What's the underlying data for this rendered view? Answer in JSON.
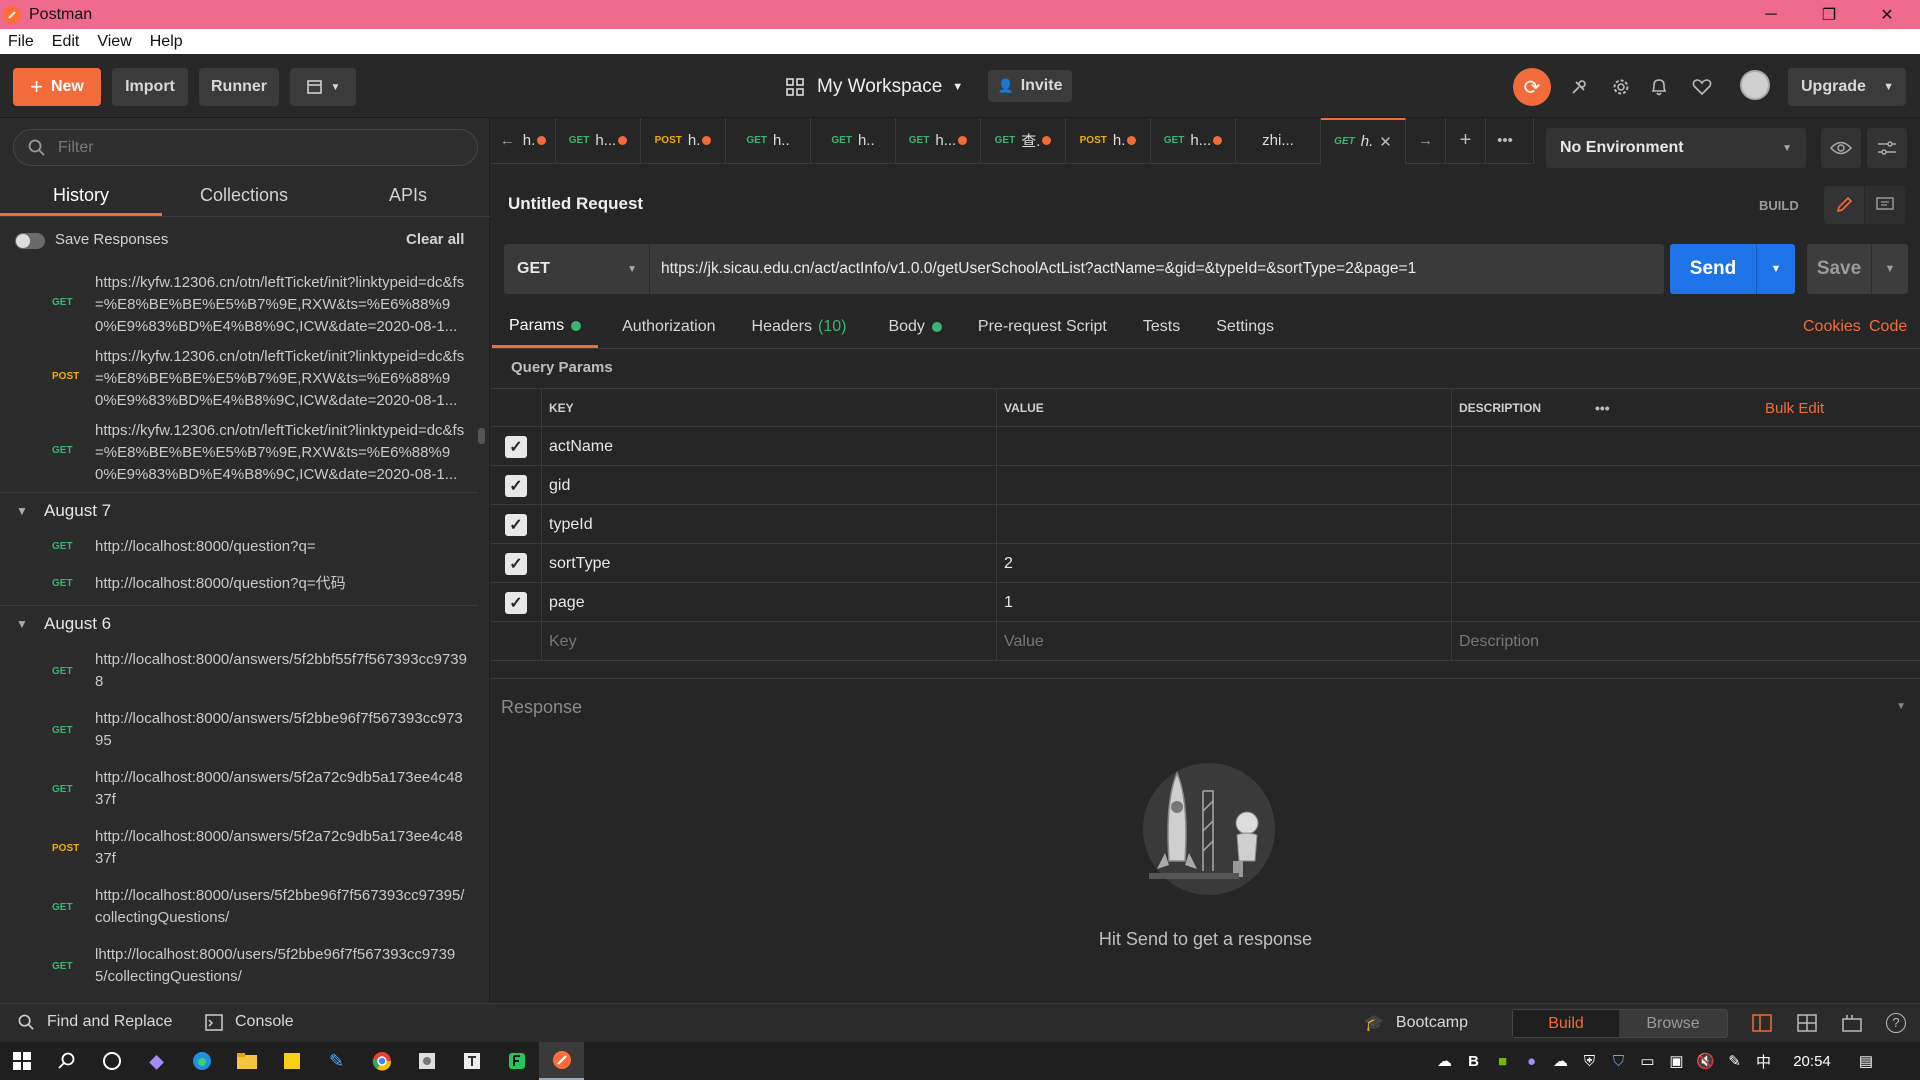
{
  "window": {
    "title": "Postman",
    "minimize": "─",
    "maximize": "❐",
    "close": "✕"
  },
  "menu": [
    "File",
    "Edit",
    "View",
    "Help"
  ],
  "toolbar": {
    "new_label": "New",
    "import_label": "Import",
    "runner_label": "Runner",
    "workspace_label": "My Workspace",
    "invite_label": "Invite",
    "upgrade_label": "Upgrade"
  },
  "sidebar": {
    "filter_placeholder": "Filter",
    "tabs": [
      "History",
      "Collections",
      "APIs"
    ],
    "save_responses_label": "Save Responses",
    "clear_all_label": "Clear all",
    "top_items": [
      {
        "method": "GET",
        "url": "https://kyfw.12306.cn/otn/leftTicket/init?linktypeid=dc&fs=%E8%BE%BE%E5%B7%9E,RXW&ts=%E6%88%90%E9%83%BD%E4%B8%9C,ICW&date=2020-08-1..."
      },
      {
        "method": "POST",
        "url": "https://kyfw.12306.cn/otn/leftTicket/init?linktypeid=dc&fs=%E8%BE%BE%E5%B7%9E,RXW&ts=%E6%88%90%E9%83%BD%E4%B8%9C,ICW&date=2020-08-1..."
      },
      {
        "method": "GET",
        "url": "https://kyfw.12306.cn/otn/leftTicket/init?linktypeid=dc&fs=%E8%BE%BE%E5%B7%9E,RXW&ts=%E6%88%90%E9%83%BD%E4%B8%9C,ICW&date=2020-08-1..."
      }
    ],
    "group_aug7": {
      "label": "August 7",
      "items": [
        {
          "method": "GET",
          "url": "http://localhost:8000/question?q="
        },
        {
          "method": "GET",
          "url": "http://localhost:8000/question?q=代码"
        }
      ]
    },
    "group_aug6": {
      "label": "August 6",
      "items": [
        {
          "method": "GET",
          "url": "http://localhost:8000/answers/5f2bbf55f7f567393cc97398"
        },
        {
          "method": "GET",
          "url": "http://localhost:8000/answers/5f2bbe96f7f567393cc97395"
        },
        {
          "method": "GET",
          "url": "http://localhost:8000/answers/5f2a72c9db5a173ee4c4837f"
        },
        {
          "method": "POST",
          "url": "http://localhost:8000/answers/5f2a72c9db5a173ee4c4837f"
        },
        {
          "method": "GET",
          "url": "http://localhost:8000/users/5f2bbe96f7f567393cc97395/collectingQuestions/"
        },
        {
          "method": "GET",
          "url": "lhttp://localhost:8000/users/5f2bbe96f7f567393cc97395/collectingQuestions/"
        }
      ]
    }
  },
  "request_tabs": [
    {
      "method": "GET",
      "label": "h..."
    },
    {
      "method": "POST",
      "label": "h."
    },
    {
      "method": "GET",
      "label": "h.."
    },
    {
      "method": "GET",
      "label": "h.."
    },
    {
      "method": "GET",
      "label": "h..."
    },
    {
      "method": "GET",
      "label": "查."
    },
    {
      "method": "POST",
      "label": "h."
    },
    {
      "method": "GET",
      "label": "h..."
    },
    {
      "method": "",
      "label": "zhi..."
    },
    {
      "method": "GET",
      "label": "h."
    }
  ],
  "first_tab_label": "h.",
  "environment": {
    "label": "No Environment"
  },
  "request": {
    "title": "Untitled Request",
    "build_label": "BUILD",
    "method": "GET",
    "url": "https://jk.sicau.edu.cn/act/actInfo/v1.0.0/getUserSchoolActList?actName=&gid=&typeId=&sortType=2&page=1",
    "send_label": "Send",
    "save_label": "Save"
  },
  "param_tabs": {
    "params": "Params",
    "authorization": "Authorization",
    "headers": "Headers",
    "headers_count": "(10)",
    "body": "Body",
    "prerequest": "Pre-request Script",
    "tests": "Tests",
    "settings": "Settings",
    "cookies": "Cookies",
    "code": "Code"
  },
  "query_params": {
    "title": "Query Params",
    "headers": {
      "key": "KEY",
      "value": "VALUE",
      "description": "DESCRIPTION",
      "bulk_edit": "Bulk Edit",
      "more": "•••"
    },
    "rows": [
      {
        "key": "actName",
        "value": ""
      },
      {
        "key": "gid",
        "value": ""
      },
      {
        "key": "typeId",
        "value": ""
      },
      {
        "key": "sortType",
        "value": "2"
      },
      {
        "key": "page",
        "value": "1"
      }
    ],
    "placeholders": {
      "key": "Key",
      "value": "Value",
      "description": "Description"
    }
  },
  "response": {
    "title": "Response",
    "hint": "Hit Send to get a response"
  },
  "footer": {
    "find_replace": "Find and Replace",
    "console": "Console",
    "bootcamp": "Bootcamp",
    "build": "Build",
    "browse": "Browse"
  },
  "taskbar": {
    "time": "20:54",
    "ime": "中"
  },
  "colors": {
    "accent": "#f26b3a",
    "send": "#1f73e8",
    "get": "#3cb371",
    "post": "#f0ad00",
    "titlebar": "#f06a8e"
  }
}
